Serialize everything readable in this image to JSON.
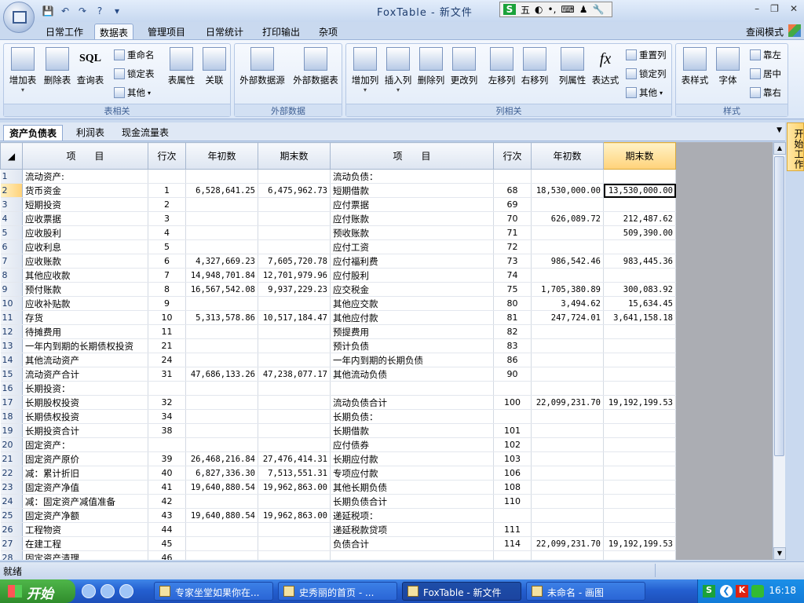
{
  "window": {
    "title": "FoxTable - 新文件",
    "minimize": "–",
    "restore": "❐",
    "close": "✕"
  },
  "qat": {
    "save": "💾",
    "undo": "↶",
    "redo": "↷",
    "help": "?",
    "more": "▾"
  },
  "ime": {
    "s": "S",
    "wu": "五",
    "moon": "◐",
    "dot": "•,",
    "kb": "⌨",
    "person": "♟",
    "tool": "🔧"
  },
  "tabs": [
    {
      "label": "日常工作"
    },
    {
      "label": "数据表"
    },
    {
      "label": "管理项目"
    },
    {
      "label": "日常统计"
    },
    {
      "label": "打印输出"
    },
    {
      "label": "杂项"
    }
  ],
  "query_mode": "查阅模式",
  "ribbon": {
    "groups": {
      "table": "表相关",
      "external": "外部数据",
      "column": "列相关",
      "style": "样式"
    },
    "buttons": {
      "add_table": "增加表",
      "delete_table": "删除表",
      "query_table": "查询表",
      "rename": "重命名",
      "lock_table": "锁定表",
      "other1": "其他",
      "table_props": "表属性",
      "relation": "关联",
      "ext_source": "外部数据源",
      "ext_table": "外部数据表",
      "add_col": "增加列",
      "insert_col": "插入列",
      "delete_col": "删除列",
      "change_col": "更改列",
      "move_left": "左移列",
      "move_right": "右移列",
      "col_props": "列属性",
      "expression": "表达式",
      "reset_col": "重置列",
      "lock_col": "锁定列",
      "other2": "其他",
      "table_style": "表样式",
      "font": "字体",
      "align_left": "靠左",
      "align_center": "居中",
      "align_right": "靠右"
    },
    "sql_icon_text": "SQL",
    "fx_icon_text": "fx"
  },
  "sheet_tabs": [
    {
      "label": "资产负债表"
    },
    {
      "label": "利润表"
    },
    {
      "label": "现金流量表"
    }
  ],
  "side_panel": "开始工作",
  "grid": {
    "headers": [
      "项　　目",
      "行次",
      "年初数",
      "期末数",
      "项　　目",
      "行次",
      "年初数",
      "期末数"
    ],
    "rows": [
      [
        "1",
        "流动资产:",
        "",
        "",
        "",
        "流动负债：",
        "",
        "",
        ""
      ],
      [
        "2",
        "货币资金",
        "1",
        "6,528,641.25",
        "6,475,962.73",
        "短期借款",
        "68",
        "18,530,000.00",
        "13,530,000.00"
      ],
      [
        "3",
        "短期投资",
        "2",
        "",
        "",
        "应付票据",
        "69",
        "",
        ""
      ],
      [
        "4",
        "应收票据",
        "3",
        "",
        "",
        "应付账款",
        "70",
        "626,089.72",
        "212,487.62"
      ],
      [
        "5",
        "应收股利",
        "4",
        "",
        "",
        "预收账款",
        "71",
        "",
        "509,390.00"
      ],
      [
        "6",
        "应收利息",
        "5",
        "",
        "",
        "应付工资",
        "72",
        "",
        ""
      ],
      [
        "7",
        "应收账款",
        "6",
        "4,327,669.23",
        "7,605,720.78",
        "应付福利费",
        "73",
        "986,542.46",
        "983,445.36"
      ],
      [
        "8",
        "其他应收款",
        "7",
        "14,948,701.84",
        "12,701,979.96",
        "应付股利",
        "74",
        "",
        ""
      ],
      [
        "9",
        "预付账款",
        "8",
        "16,567,542.08",
        "9,937,229.23",
        "应交税金",
        "75",
        "1,705,380.89",
        "300,083.92"
      ],
      [
        "10",
        "应收补贴款",
        "9",
        "",
        "",
        "其他应交款",
        "80",
        "3,494.62",
        "15,634.45"
      ],
      [
        "11",
        "存货",
        "10",
        "5,313,578.86",
        "10,517,184.47",
        "其他应付款",
        "81",
        "247,724.01",
        "3,641,158.18"
      ],
      [
        "12",
        "待摊费用",
        "11",
        "",
        "",
        "预提费用",
        "82",
        "",
        ""
      ],
      [
        "13",
        "一年内到期的长期债权投资",
        "21",
        "",
        "",
        "预计负债",
        "83",
        "",
        ""
      ],
      [
        "14",
        "其他流动资产",
        "24",
        "",
        "",
        "一年内到期的长期负债",
        "86",
        "",
        ""
      ],
      [
        "15",
        "流动资产合计",
        "31",
        "47,686,133.26",
        "47,238,077.17",
        "其他流动负债",
        "90",
        "",
        ""
      ],
      [
        "16",
        "长期投资：",
        "",
        "",
        "",
        "",
        "",
        "",
        ""
      ],
      [
        "17",
        "长期股权投资",
        "32",
        "",
        "",
        "流动负债合计",
        "100",
        "22,099,231.70",
        "19,192,199.53"
      ],
      [
        "18",
        "长期债权投资",
        "34",
        "",
        "",
        "长期负债：",
        "",
        "",
        ""
      ],
      [
        "19",
        "长期投资合计",
        "38",
        "",
        "",
        "长期借款",
        "101",
        "",
        ""
      ],
      [
        "20",
        "固定资产：",
        "",
        "",
        "",
        "应付债券",
        "102",
        "",
        ""
      ],
      [
        "21",
        "固定资产原价",
        "39",
        "26,468,216.84",
        "27,476,414.31",
        "长期应付款",
        "103",
        "",
        ""
      ],
      [
        "22",
        "减：累计折旧",
        "40",
        "6,827,336.30",
        "7,513,551.31",
        "专项应付款",
        "106",
        "",
        ""
      ],
      [
        "23",
        "固定资产净值",
        "41",
        "19,640,880.54",
        "19,962,863.00",
        "其他长期负债",
        "108",
        "",
        ""
      ],
      [
        "24",
        "减：固定资产减值准备",
        "42",
        "",
        "",
        "长期负债合计",
        "110",
        "",
        ""
      ],
      [
        "25",
        "固定资产净额",
        "43",
        "19,640,880.54",
        "19,962,863.00",
        "递延税项：",
        "",
        "",
        ""
      ],
      [
        "26",
        "工程物资",
        "44",
        "",
        "",
        "递延税款贷项",
        "111",
        "",
        ""
      ],
      [
        "27",
        "在建工程",
        "45",
        "",
        "",
        "负债合计",
        "114",
        "22,099,231.70",
        "19,192,199.53"
      ],
      [
        "28",
        "固定资产清理",
        "46",
        "",
        "",
        "",
        "",
        "",
        ""
      ]
    ]
  },
  "status": "就绪",
  "taskbar": {
    "start": "开始",
    "tasks": [
      {
        "label": "专家坐堂如果你在..."
      },
      {
        "label": "史秀丽的首页 - ..."
      },
      {
        "label": "FoxTable - 新文件"
      },
      {
        "label": "未命名 - 画图"
      }
    ],
    "tray": {
      "s": "S",
      "arrow": "❮",
      "k": "K"
    },
    "clock": "16:18"
  }
}
